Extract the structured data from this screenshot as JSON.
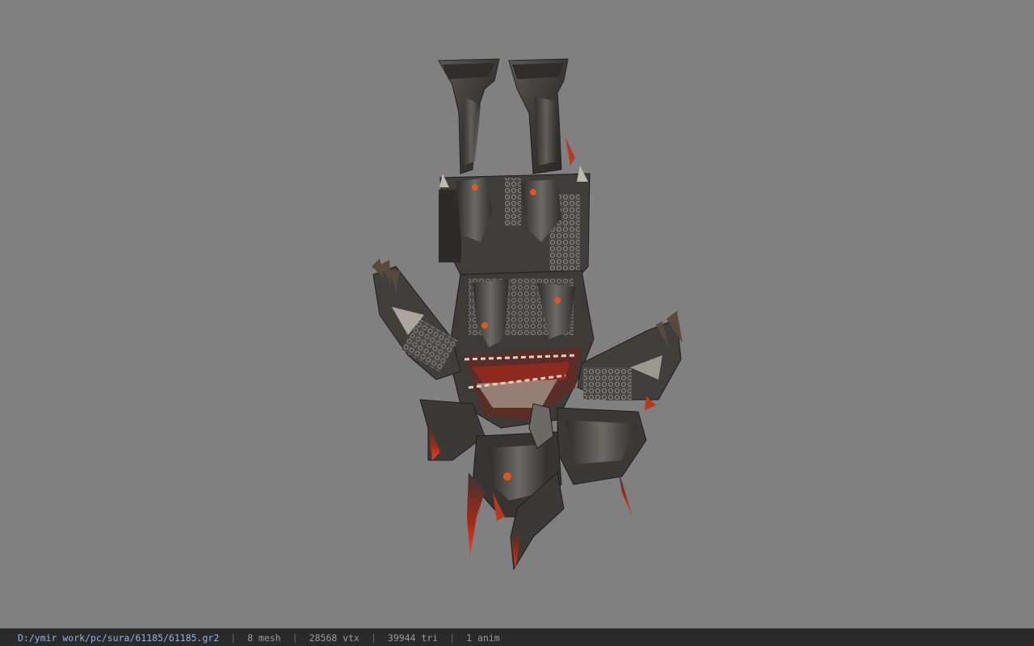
{
  "viewer": {
    "background_color": "#808080",
    "model_icon": "upside-down-armored-character-model"
  },
  "statusbar": {
    "file_path": "D:/ymir work/pc/sura/61185/61185.gr2",
    "separator": "|",
    "mesh_count": "8 mesh",
    "vertex_count": "28568 vtx",
    "triangle_count": "39944 tri",
    "anim_count": "1 anim"
  }
}
